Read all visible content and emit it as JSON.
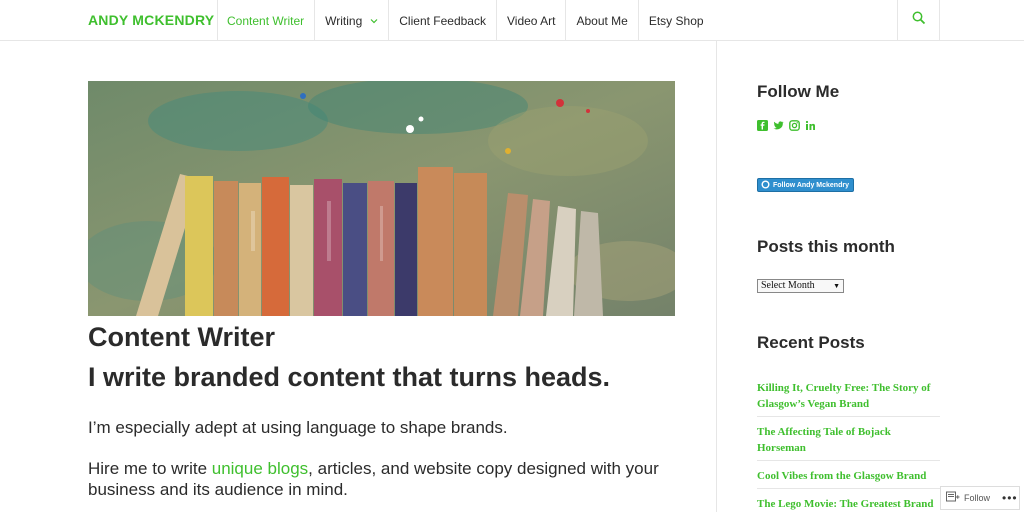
{
  "site": {
    "title": "ANDY MCKENDRY"
  },
  "nav": {
    "items": [
      {
        "label": "Content Writer",
        "active": true
      },
      {
        "label": "Writing",
        "has_dropdown": true
      },
      {
        "label": "Client Feedback"
      },
      {
        "label": "Video Art"
      },
      {
        "label": "About Me"
      },
      {
        "label": "Etsy Shop"
      }
    ],
    "search_icon": "search-icon"
  },
  "main": {
    "title": "Content Writer",
    "subtitle": "I write branded content that turns heads.",
    "para1": "I’m especially adept at using language to shape brands.",
    "para2_prefix": "Hire me to write ",
    "para2_link": "unique blogs",
    "para2_suffix": ", articles, and website copy designed with your business and its audience in mind."
  },
  "sidebar": {
    "follow_title": "Follow Me",
    "social_icons": [
      "facebook-icon",
      "twitter-icon",
      "instagram-icon",
      "linkedin-icon"
    ],
    "follow_badge": "Follow Andy Mckendry",
    "archive_title": "Posts this month",
    "archive_select": "Select Month",
    "recent_title": "Recent Posts",
    "recent_posts": [
      "Killing It, Cruelty Free: The Story of Glasgow’s Vegan Brand",
      "The Affecting Tale of Bojack Horseman",
      "Cool Vibes from the Glasgow Brand",
      "The Lego Movie: The Greatest Brand"
    ]
  },
  "floating": {
    "follow_label": "Follow",
    "more": "•••"
  },
  "colors": {
    "accent": "#3fbf2e",
    "text": "#2b2b2b",
    "border": "#e6e6e6"
  }
}
